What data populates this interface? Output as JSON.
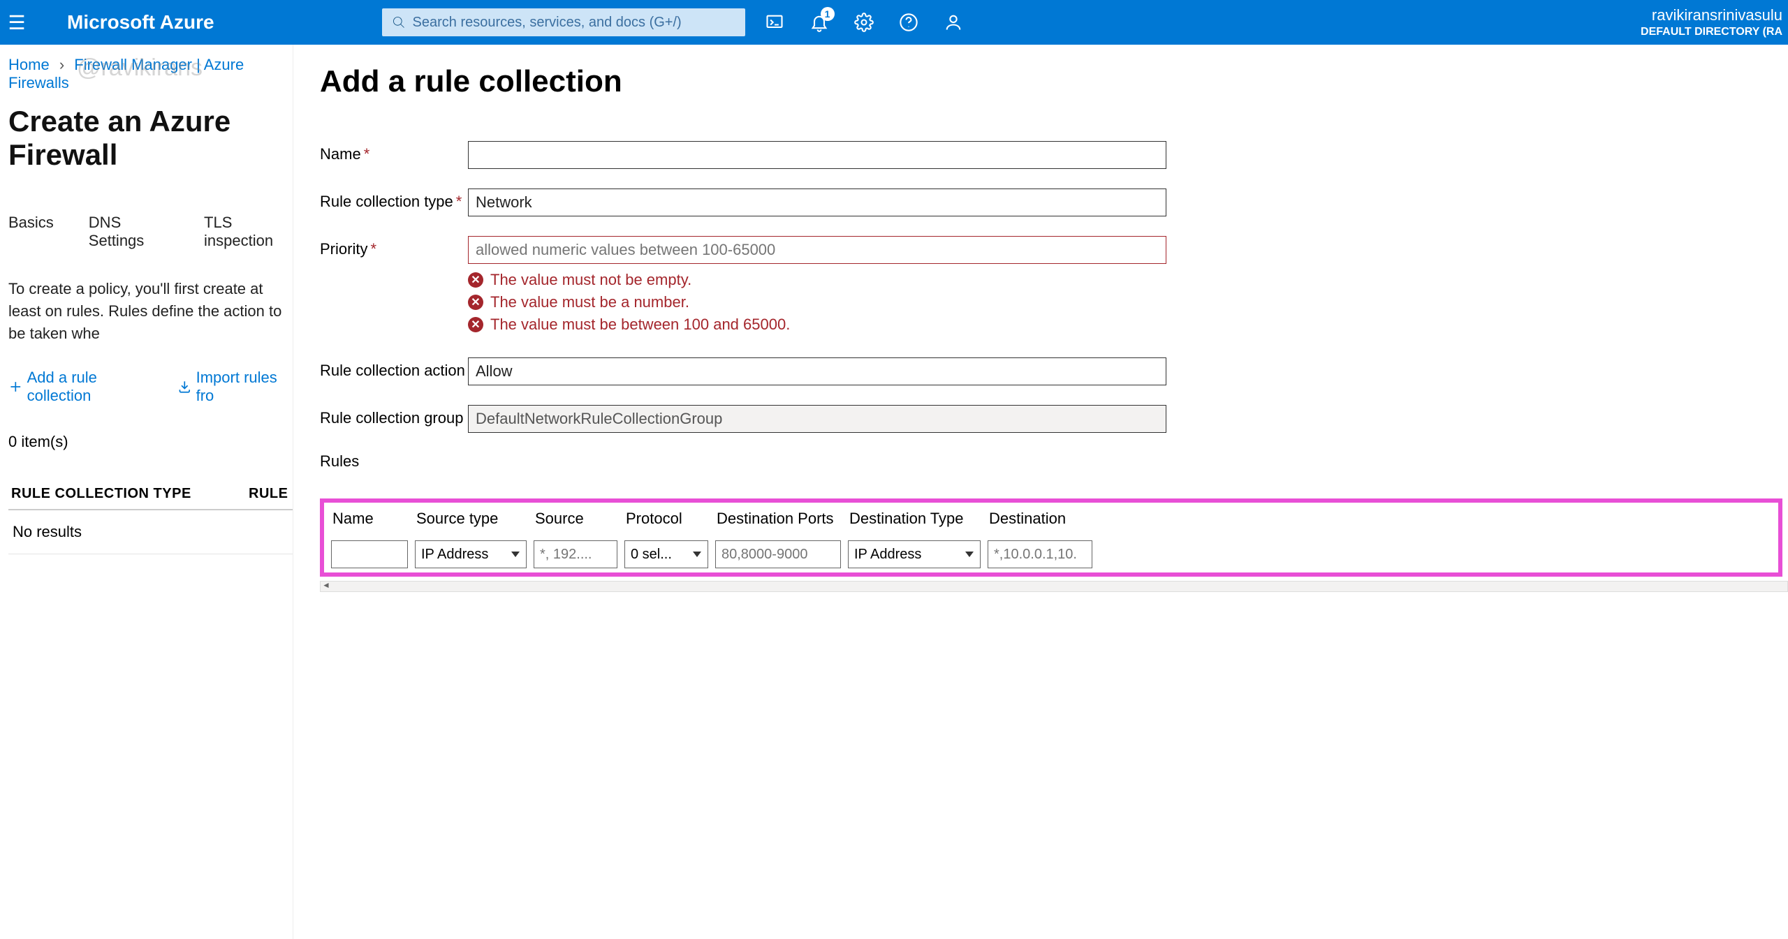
{
  "header": {
    "brand": "Microsoft Azure",
    "search_placeholder": "Search resources, services, and docs (G+/)",
    "notification_count": "1",
    "account_user": "ravikiransrinivasulu",
    "account_dir": "DEFAULT DIRECTORY (RA"
  },
  "breadcrumb": {
    "home": "Home",
    "path": "Firewall Manager | Azure Firewalls"
  },
  "watermark": "@ravikirans",
  "left": {
    "title": "Create an Azure Firewall",
    "tabs": [
      "Basics",
      "DNS Settings",
      "TLS inspection"
    ],
    "description": "To create a policy, you'll first create at least on rules. Rules define the action to be taken whe",
    "action_add": "Add a rule collection",
    "action_import": "Import rules fro",
    "items_label": "0 item(s)",
    "col1": "RULE COLLECTION TYPE",
    "col2": "RULE",
    "noresults": "No results"
  },
  "panel": {
    "title": "Add a rule collection",
    "labels": {
      "name": "Name",
      "type": "Rule collection type",
      "priority": "Priority",
      "action": "Rule collection action",
      "group": "Rule collection group",
      "rules": "Rules"
    },
    "values": {
      "name": "",
      "type": "Network",
      "priority_placeholder": "allowed numeric values between 100-65000",
      "action": "Allow",
      "group": "DefaultNetworkRuleCollectionGroup"
    },
    "errors": [
      "The value must not be empty.",
      "The value must be a number.",
      "The value must be between 100 and 65000."
    ],
    "rules_table": {
      "headers": [
        "Name",
        "Source type",
        "Source",
        "Protocol",
        "Destination Ports",
        "Destination Type",
        "Destination"
      ],
      "row": {
        "name": "",
        "source_type": "IP Address",
        "source_placeholder": "*, 192....",
        "protocol": "0 sel...",
        "dports_placeholder": "80,8000-9000",
        "dest_type": "IP Address",
        "dest_placeholder": "*,10.0.0.1,10."
      }
    }
  }
}
